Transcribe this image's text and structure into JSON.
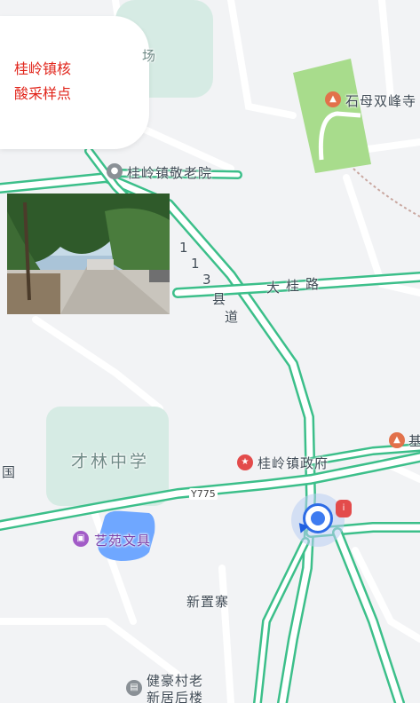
{
  "callout": {
    "line1": "桂岭镇核",
    "line2": "酸采样点"
  },
  "pois": {
    "nursing_home": "桂岭镇敬老院",
    "temple": "石母双峰寺",
    "government": "桂岭镇政府",
    "school": "才林中学",
    "stationery": "艺苑文具",
    "village": "新置寨",
    "building_line1": "健豪村老",
    "building_line2": "新居后楼",
    "partial_left": "场",
    "partial_right": "基",
    "partial_edge": "国"
  },
  "roads": {
    "county_road": [
      "1",
      "1",
      "3",
      "县",
      "道"
    ],
    "da_gui_road": [
      "大",
      "桂",
      "路"
    ],
    "y775": "Y775"
  },
  "icons": {
    "temple_icon": "temple-icon",
    "government_icon": "star-icon",
    "stationery_icon": "shop-icon",
    "building_icon": "building-icon",
    "location_icon": "location-pin-icon",
    "user_icon": "user-location-icon"
  },
  "colors": {
    "road_green": "#3cbf8a",
    "park_green": "#a8dc8c",
    "area_fill": "#d8ece6",
    "callout_text": "#e1261c"
  }
}
